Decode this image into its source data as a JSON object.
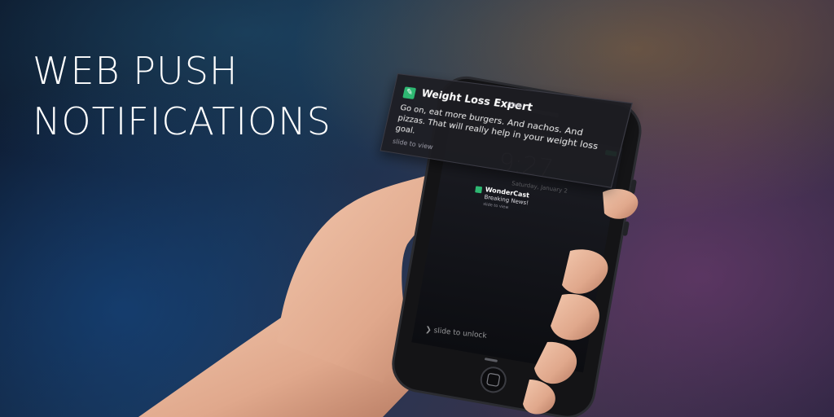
{
  "headline": {
    "line1": "WEB PUSH",
    "line2": "NOTIFICATIONS"
  },
  "notification": {
    "icon": "app-icon",
    "title": "Weight Loss Expert",
    "time": "now",
    "body": "Go on, eat more burgers. And nachos. And pizzas. That will really help in your weight loss goal.",
    "hint": "slide to view",
    "accent_color": "#2eb872"
  },
  "lock_screen": {
    "clock": "9:27",
    "date": "Saturday, January 2",
    "notification": {
      "icon": "app-icon",
      "title": "WonderCast",
      "body": "Breaking News!",
      "hint": "slide to view"
    },
    "unlock_text": "slide to unlock",
    "camera_icon": "camera-icon"
  },
  "colors": {
    "headline": "#ffffff",
    "phone_body": "#141416",
    "skin": "#e6b39a"
  }
}
